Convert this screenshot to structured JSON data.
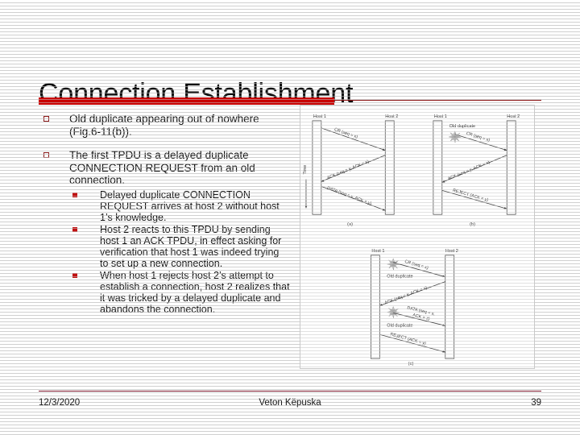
{
  "slide": {
    "title": "Connection Establishment",
    "accent_color": "#c80000",
    "rule_thin_color": "#8c1414",
    "bullet_color": "#8c1a1a",
    "subbullet_color": "#c01010"
  },
  "body": {
    "bullets": [
      {
        "text": "Old duplicate appearing out of nowhere (Fig.6-11(b)).",
        "sub": []
      },
      {
        "text": "The first TPDU is a delayed duplicate CONNECTION REQUEST from an old connection.",
        "sub": [
          "Delayed duplicate CONNECTION REQUEST arrives at host 2 without host 1’s knowledge.",
          "Host 2 reacts to this TPDU by sending host 1 an ACK TPDU, in effect asking for verification that host 1 was indeed trying to set up a new connection.",
          "When host 1 rejects host 2’s attempt to establish a connection, host 2 realizes that it was tricked by a delayed duplicate and abandons the connection."
        ]
      }
    ]
  },
  "figure": {
    "time_axis_label": "Time",
    "host1_label": "Host 1",
    "host2_label": "Host 2",
    "old_duplicate_label": "Old duplicate",
    "panels": [
      {
        "caption": "(a)",
        "messages": [
          "CR (seq = x)",
          "ACK (seq = y, ACK = x)",
          "DATA (seq = x, ACK = y)"
        ]
      },
      {
        "caption": "(b)",
        "messages": [
          "CR (seq = x)",
          "ACK (seq = y, ACK = x)",
          "REJECT (ACK = y)"
        ]
      },
      {
        "caption": "(c)",
        "messages": [
          "CR (seq = x)",
          "ACK (seq = y, ACK = x)",
          "DATA (seq = x,",
          "ACK = z)",
          "REJECT (ACK = y)"
        ]
      }
    ]
  },
  "footer": {
    "date": "12/3/2020",
    "author": "Veton Këpuska",
    "page_number": "39"
  }
}
